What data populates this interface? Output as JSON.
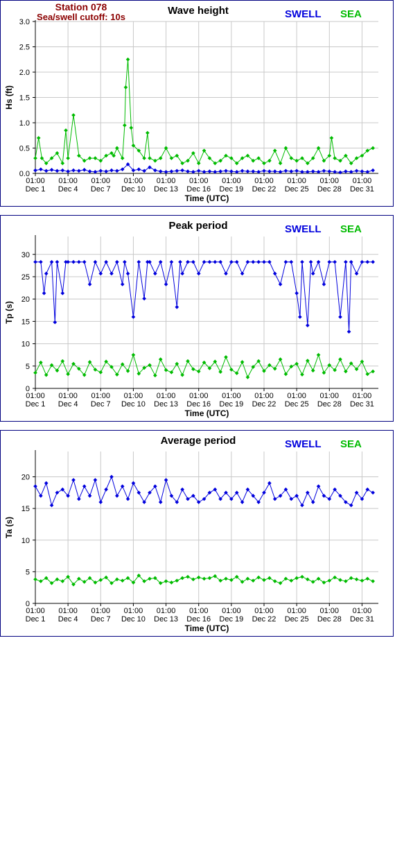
{
  "station": {
    "name": "Station 078",
    "cutoff": "Sea/swell cutoff: 10s"
  },
  "legend": {
    "swell": "SWELL",
    "sea": "SEA"
  },
  "colors": {
    "swell": "#0000dd",
    "sea": "#00bb00",
    "frame": "#000080",
    "station_text": "#8b0000"
  },
  "chart_data": [
    {
      "type": "line",
      "title": "Wave height",
      "xlabel": "Time (UTC)",
      "ylabel": "Hs (ft)",
      "ylim": [
        0,
        3.0
      ],
      "xlim": [
        0,
        31.5
      ],
      "yticks": [
        0,
        0.5,
        1.0,
        1.5,
        2.0,
        2.5,
        3.0
      ],
      "ytick_labels": [
        "0.0",
        "0.5",
        "1.0",
        "1.5",
        "2.0",
        "2.5",
        "3.0"
      ],
      "xticks": [
        {
          "day": 0,
          "time": "01:00",
          "date": "Dec 1"
        },
        {
          "day": 3,
          "time": "01:00",
          "date": "Dec 4"
        },
        {
          "day": 6,
          "time": "01:00",
          "date": "Dec 7"
        },
        {
          "day": 9,
          "time": "01:00",
          "date": "Dec 10"
        },
        {
          "day": 12,
          "time": "01:00",
          "date": "Dec 13"
        },
        {
          "day": 15,
          "time": "01:00",
          "date": "Dec 16"
        },
        {
          "day": 18,
          "time": "01:00",
          "date": "Dec 19"
        },
        {
          "day": 21,
          "time": "01:00",
          "date": "Dec 22"
        },
        {
          "day": 24,
          "time": "01:00",
          "date": "Dec 25"
        },
        {
          "day": 27,
          "time": "01:00",
          "date": "Dec 28"
        },
        {
          "day": 30,
          "time": "01:00",
          "date": "Dec 31"
        }
      ],
      "grid": true,
      "series": [
        {
          "name": "SWELL",
          "x": [
            0,
            0.5,
            1,
            1.5,
            2,
            2.5,
            3,
            3.5,
            4,
            4.5,
            5,
            5.5,
            6,
            6.5,
            7,
            7.5,
            8,
            8.5,
            9,
            9.5,
            10,
            10.5,
            11,
            11.5,
            12,
            12.5,
            13,
            13.5,
            14,
            14.5,
            15,
            15.5,
            16,
            16.5,
            17,
            17.5,
            18,
            18.5,
            19,
            19.5,
            20,
            20.5,
            21,
            21.5,
            22,
            22.5,
            23,
            23.5,
            24,
            24.5,
            25,
            25.5,
            26,
            26.5,
            27,
            27.5,
            28,
            28.5,
            29,
            29.5,
            30,
            30.5,
            31
          ],
          "values": [
            0.06,
            0.08,
            0.05,
            0.07,
            0.05,
            0.06,
            0.04,
            0.06,
            0.05,
            0.07,
            0.04,
            0.03,
            0.05,
            0.04,
            0.06,
            0.05,
            0.08,
            0.18,
            0.06,
            0.08,
            0.05,
            0.12,
            0.06,
            0.04,
            0.03,
            0.04,
            0.05,
            0.06,
            0.04,
            0.03,
            0.05,
            0.03,
            0.04,
            0.03,
            0.04,
            0.05,
            0.04,
            0.03,
            0.05,
            0.04,
            0.04,
            0.03,
            0.05,
            0.04,
            0.04,
            0.03,
            0.05,
            0.04,
            0.05,
            0.03,
            0.03,
            0.04,
            0.03,
            0.05,
            0.04,
            0.03,
            0.02,
            0.04,
            0.03,
            0.05,
            0.04,
            0.03,
            0.06
          ]
        },
        {
          "name": "SEA",
          "x": [
            0,
            0.3,
            0.6,
            1,
            1.5,
            2,
            2.5,
            2.8,
            3,
            3.5,
            4,
            4.5,
            5,
            5.5,
            6,
            6.5,
            7,
            7.2,
            7.5,
            8,
            8.2,
            8.3,
            8.5,
            8.8,
            9,
            9.5,
            10,
            10.3,
            10.5,
            11,
            11.5,
            12,
            12.5,
            13,
            13.5,
            14,
            14.5,
            15,
            15.5,
            16,
            16.5,
            17,
            17.5,
            18,
            18.5,
            19,
            19.5,
            20,
            20.5,
            21,
            21.5,
            22,
            22.5,
            23,
            23.5,
            24,
            24.5,
            25,
            25.5,
            26,
            26.5,
            27,
            27.2,
            27.5,
            28,
            28.5,
            29,
            29.5,
            30,
            30.5,
            31
          ],
          "values": [
            0.3,
            0.7,
            0.3,
            0.2,
            0.3,
            0.4,
            0.2,
            0.85,
            0.3,
            1.15,
            0.35,
            0.25,
            0.3,
            0.3,
            0.25,
            0.35,
            0.4,
            0.35,
            0.5,
            0.3,
            0.95,
            1.7,
            2.25,
            0.9,
            0.55,
            0.45,
            0.3,
            0.8,
            0.3,
            0.25,
            0.3,
            0.5,
            0.3,
            0.35,
            0.2,
            0.25,
            0.4,
            0.2,
            0.45,
            0.3,
            0.2,
            0.25,
            0.35,
            0.3,
            0.2,
            0.3,
            0.35,
            0.25,
            0.3,
            0.2,
            0.25,
            0.45,
            0.2,
            0.5,
            0.3,
            0.25,
            0.3,
            0.2,
            0.3,
            0.5,
            0.25,
            0.35,
            0.7,
            0.3,
            0.25,
            0.35,
            0.2,
            0.3,
            0.35,
            0.45,
            0.5
          ]
        }
      ]
    },
    {
      "type": "line",
      "title": "Peak period",
      "xlabel": "Time (UTC)",
      "ylabel": "Tp (s)",
      "ylim": [
        0,
        34
      ],
      "xlim": [
        0,
        31.5
      ],
      "yticks": [
        0,
        5,
        10,
        15,
        20,
        25,
        30
      ],
      "ytick_labels": [
        "0",
        "5",
        "10",
        "15",
        "20",
        "25",
        "30"
      ],
      "xticks": [
        {
          "day": 0,
          "time": "01:00",
          "date": "Dec 1"
        },
        {
          "day": 3,
          "time": "01:00",
          "date": "Dec 4"
        },
        {
          "day": 6,
          "time": "01:00",
          "date": "Dec 7"
        },
        {
          "day": 9,
          "time": "01:00",
          "date": "Dec 10"
        },
        {
          "day": 12,
          "time": "01:00",
          "date": "Dec 13"
        },
        {
          "day": 15,
          "time": "01:00",
          "date": "Dec 16"
        },
        {
          "day": 18,
          "time": "01:00",
          "date": "Dec 19"
        },
        {
          "day": 21,
          "time": "01:00",
          "date": "Dec 22"
        },
        {
          "day": 24,
          "time": "01:00",
          "date": "Dec 25"
        },
        {
          "day": 27,
          "time": "01:00",
          "date": "Dec 28"
        },
        {
          "day": 30,
          "time": "01:00",
          "date": "Dec 31"
        }
      ],
      "grid": true,
      "series": [
        {
          "name": "SWELL",
          "x": [
            0,
            0.5,
            0.8,
            1,
            1.5,
            1.8,
            2,
            2.5,
            2.8,
            3,
            3.5,
            4,
            4.5,
            5,
            5.5,
            6,
            6.5,
            7,
            7.5,
            8,
            8.2,
            8.5,
            9,
            9.5,
            10,
            10.3,
            10.5,
            11,
            11.5,
            12,
            12.5,
            13,
            13.3,
            13.5,
            14,
            14.5,
            15,
            15.5,
            16,
            16.5,
            17,
            17.5,
            18,
            18.5,
            19,
            19.5,
            20,
            20.5,
            21,
            21.5,
            22,
            22.5,
            23,
            23.5,
            24,
            24.3,
            24.5,
            25,
            25.3,
            25.5,
            26,
            26.5,
            27,
            27.5,
            28,
            28.5,
            28.8,
            29,
            29.5,
            30,
            30.5,
            31
          ],
          "values": [
            28.3,
            28.3,
            21.3,
            25.7,
            28.3,
            14.8,
            28.3,
            21.3,
            28.3,
            28.3,
            28.3,
            28.3,
            28.3,
            23.3,
            28.3,
            25.7,
            28.3,
            25.7,
            28.3,
            23.3,
            28.3,
            25.7,
            16.0,
            28.3,
            20.1,
            28.3,
            28.3,
            25.7,
            28.3,
            23.3,
            28.3,
            18.2,
            28.3,
            25.7,
            28.3,
            28.3,
            25.7,
            28.3,
            28.3,
            28.3,
            28.3,
            25.7,
            28.3,
            28.3,
            25.7,
            28.3,
            28.3,
            28.3,
            28.3,
            28.3,
            25.7,
            23.3,
            28.3,
            28.3,
            21.3,
            16.0,
            28.3,
            14.1,
            28.3,
            25.7,
            28.3,
            23.3,
            28.3,
            28.3,
            16.0,
            28.3,
            12.7,
            28.3,
            25.7,
            28.3,
            28.3,
            28.3
          ]
        },
        {
          "name": "SEA",
          "x": [
            0,
            0.5,
            1,
            1.5,
            2,
            2.5,
            3,
            3.5,
            4,
            4.5,
            5,
            5.5,
            6,
            6.5,
            7,
            7.5,
            8,
            8.5,
            9,
            9.5,
            10,
            10.5,
            11,
            11.5,
            12,
            12.5,
            13,
            13.5,
            14,
            14.5,
            15,
            15.5,
            16,
            16.5,
            17,
            17.5,
            18,
            18.5,
            19,
            19.5,
            20,
            20.5,
            21,
            21.5,
            22,
            22.5,
            23,
            23.5,
            24,
            24.5,
            25,
            25.5,
            26,
            26.5,
            27,
            27.5,
            28,
            28.5,
            29,
            29.5,
            30,
            30.5,
            31
          ],
          "values": [
            3.5,
            5.8,
            3.0,
            5.2,
            4.0,
            6.1,
            3.2,
            5.5,
            4.4,
            3.0,
            5.9,
            4.2,
            3.6,
            6.0,
            4.8,
            3.1,
            5.4,
            3.9,
            7.5,
            3.3,
            4.6,
            5.2,
            2.9,
            6.5,
            4.1,
            3.6,
            5.5,
            3.0,
            6.1,
            4.3,
            3.8,
            5.8,
            4.5,
            6.0,
            3.7,
            7.0,
            4.2,
            3.4,
            5.9,
            2.5,
            4.8,
            6.1,
            3.9,
            5.2,
            4.4,
            6.5,
            3.2,
            4.9,
            5.5,
            3.1,
            6.2,
            4.0,
            7.5,
            3.5,
            5.2,
            4.1,
            6.5,
            3.8,
            5.6,
            4.3,
            6.0,
            3.2,
            3.8
          ]
        }
      ]
    },
    {
      "type": "line",
      "title": "Average period",
      "xlabel": "Time (UTC)",
      "ylabel": "Ta (s)",
      "ylim": [
        0,
        24
      ],
      "xlim": [
        0,
        31.5
      ],
      "yticks": [
        0,
        5,
        10,
        15,
        20
      ],
      "ytick_labels": [
        "0",
        "5",
        "10",
        "15",
        "20"
      ],
      "xticks": [
        {
          "day": 0,
          "time": "01:00",
          "date": "Dec 1"
        },
        {
          "day": 3,
          "time": "01:00",
          "date": "Dec 4"
        },
        {
          "day": 6,
          "time": "01:00",
          "date": "Dec 7"
        },
        {
          "day": 9,
          "time": "01:00",
          "date": "Dec 10"
        },
        {
          "day": 12,
          "time": "01:00",
          "date": "Dec 13"
        },
        {
          "day": 15,
          "time": "01:00",
          "date": "Dec 16"
        },
        {
          "day": 18,
          "time": "01:00",
          "date": "Dec 19"
        },
        {
          "day": 21,
          "time": "01:00",
          "date": "Dec 22"
        },
        {
          "day": 24,
          "time": "01:00",
          "date": "Dec 25"
        },
        {
          "day": 27,
          "time": "01:00",
          "date": "Dec 28"
        },
        {
          "day": 30,
          "time": "01:00",
          "date": "Dec 31"
        }
      ],
      "grid": true,
      "series": [
        {
          "name": "SWELL",
          "x": [
            0,
            0.5,
            1,
            1.5,
            2,
            2.5,
            3,
            3.5,
            4,
            4.5,
            5,
            5.5,
            6,
            6.5,
            7,
            7.5,
            8,
            8.5,
            9,
            9.5,
            10,
            10.5,
            11,
            11.5,
            12,
            12.5,
            13,
            13.5,
            14,
            14.5,
            15,
            15.5,
            16,
            16.5,
            17,
            17.5,
            18,
            18.5,
            19,
            19.5,
            20,
            20.5,
            21,
            21.5,
            22,
            22.5,
            23,
            23.5,
            24,
            24.5,
            25,
            25.5,
            26,
            26.5,
            27,
            27.5,
            28,
            28.5,
            29,
            29.5,
            30,
            30.5,
            31
          ],
          "values": [
            18.5,
            17.0,
            19.0,
            15.5,
            17.5,
            18.0,
            17.0,
            19.5,
            16.5,
            18.5,
            17.0,
            19.5,
            16.0,
            18.0,
            20.0,
            17.0,
            18.5,
            16.5,
            19.0,
            17.5,
            16.0,
            17.5,
            18.5,
            16.0,
            19.5,
            17.0,
            16.0,
            18.0,
            16.5,
            17.0,
            16.0,
            16.5,
            17.5,
            18.0,
            16.5,
            17.5,
            16.5,
            17.5,
            16.0,
            18.0,
            17.0,
            16.0,
            17.5,
            19.0,
            16.5,
            17.0,
            18.0,
            16.5,
            17.0,
            15.5,
            17.5,
            16.0,
            18.5,
            17.0,
            16.5,
            18.0,
            17.0,
            16.0,
            15.5,
            17.5,
            16.5,
            18.0,
            17.5
          ]
        },
        {
          "name": "SEA",
          "x": [
            0,
            0.5,
            1,
            1.5,
            2,
            2.5,
            3,
            3.5,
            4,
            4.5,
            5,
            5.5,
            6,
            6.5,
            7,
            7.5,
            8,
            8.5,
            9,
            9.5,
            10,
            10.5,
            11,
            11.5,
            12,
            12.5,
            13,
            13.5,
            14,
            14.5,
            15,
            15.5,
            16,
            16.5,
            17,
            17.5,
            18,
            18.5,
            19,
            19.5,
            20,
            20.5,
            21,
            21.5,
            22,
            22.5,
            23,
            23.5,
            24,
            24.5,
            25,
            25.5,
            26,
            26.5,
            27,
            27.5,
            28,
            28.5,
            29,
            29.5,
            30,
            30.5,
            31
          ],
          "values": [
            3.8,
            3.5,
            4.0,
            3.2,
            3.8,
            3.5,
            4.2,
            3.0,
            3.9,
            3.4,
            4.0,
            3.3,
            3.7,
            4.1,
            3.2,
            3.8,
            3.6,
            4.0,
            3.3,
            4.4,
            3.5,
            3.9,
            4.0,
            3.2,
            3.5,
            3.3,
            3.6,
            4.0,
            4.2,
            3.8,
            4.1,
            3.9,
            4.0,
            4.3,
            3.6,
            3.9,
            3.7,
            4.2,
            3.4,
            3.9,
            3.6,
            4.1,
            3.7,
            4.0,
            3.5,
            3.2,
            3.9,
            3.6,
            4.0,
            4.2,
            3.8,
            3.4,
            3.9,
            3.3,
            3.6,
            4.1,
            3.7,
            3.5,
            4.0,
            3.8,
            3.6,
            3.9,
            3.5
          ]
        }
      ]
    }
  ]
}
